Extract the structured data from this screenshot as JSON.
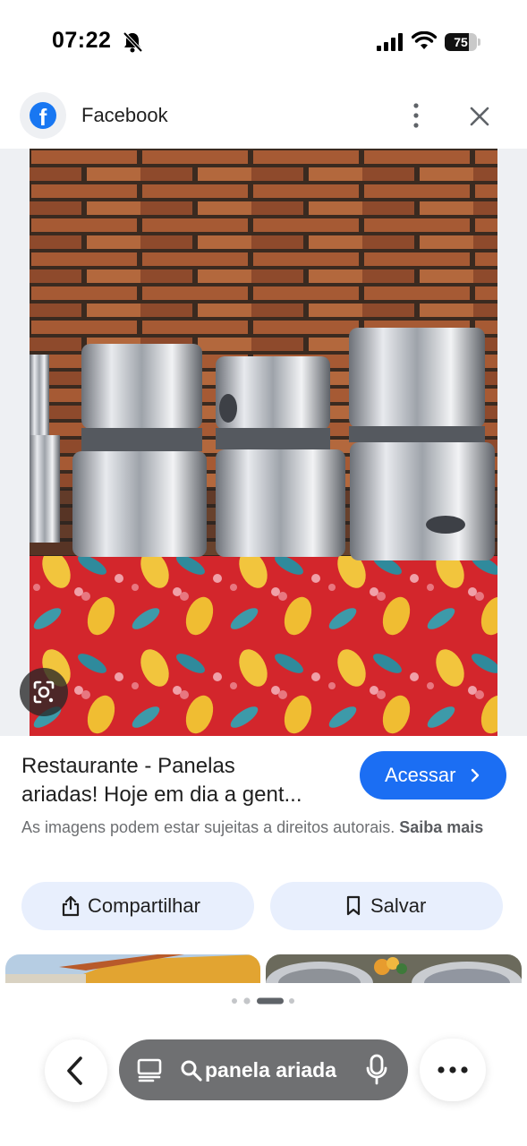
{
  "status_bar": {
    "time": "07:22",
    "battery_level": "75",
    "icons": [
      "bell-slash-icon",
      "signal-icon",
      "wifi-icon",
      "battery-icon"
    ]
  },
  "header": {
    "source": "Facebook",
    "source_icon": "facebook-icon",
    "more_icon": "more-vertical-icon",
    "close_icon": "close-icon"
  },
  "image": {
    "lens_icon": "lens-icon"
  },
  "result": {
    "title_line1": "Restaurante - Panelas",
    "title_line2": "ariadas! Hoje em dia a gent...",
    "visit_label": "Acessar",
    "copyright_notice": "As imagens podem estar sujeitas a direitos autorais.",
    "learn_more": "Saiba mais"
  },
  "actions": {
    "share_label": "Compartilhar",
    "save_label": "Salvar"
  },
  "bottom_bar": {
    "search_query": "panela ariada",
    "icons": [
      "back-icon",
      "tabs-icon",
      "search-icon",
      "mic-icon",
      "more-horizontal-icon"
    ]
  },
  "colors": {
    "accent": "#1b6ef3",
    "pill_bg": "#e8effd",
    "search_bar_bg": "#6f7072",
    "facebook_blue": "#1877f2"
  }
}
